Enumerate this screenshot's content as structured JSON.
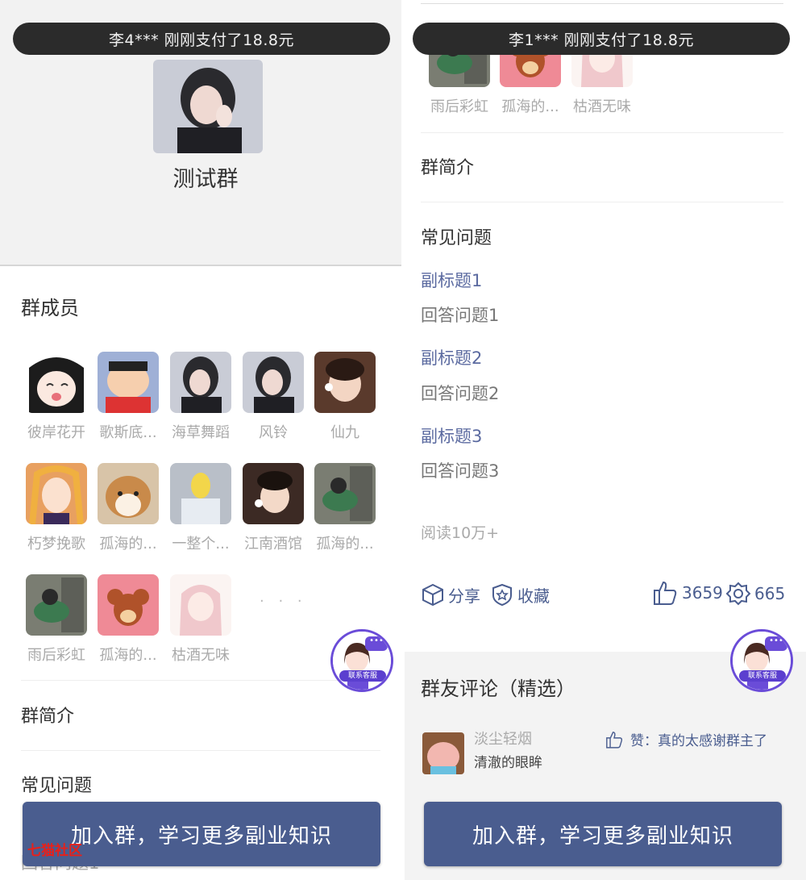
{
  "left": {
    "toast": "李4*** 刚刚支付了18.8元",
    "group_name": "测试群",
    "members_title": "群成员",
    "members": [
      {
        "name": "彼岸花开"
      },
      {
        "name": "歌斯底..."
      },
      {
        "name": "海草舞蹈"
      },
      {
        "name": "风铃"
      },
      {
        "name": "仙九"
      },
      {
        "name": "朽梦挽歌"
      },
      {
        "name": "孤海的..."
      },
      {
        "name": "一整个..."
      },
      {
        "name": "江南酒馆"
      },
      {
        "name": "孤海的..."
      },
      {
        "name": "雨后彩虹"
      },
      {
        "name": "孤海的..."
      },
      {
        "name": "枯酒无味"
      }
    ],
    "more": "· · ·",
    "intro_title": "群简介",
    "faq_title": "常见问题",
    "partial_text": "回答问题1",
    "cta": "加入群，学习更多副业知识",
    "watermark": "七猫社区",
    "service_label": "联系客服"
  },
  "right": {
    "toast": "李1*** 刚刚支付了18.8元",
    "top_members": [
      {
        "name": "雨后彩虹"
      },
      {
        "name": "孤海的..."
      },
      {
        "name": "枯酒无味"
      }
    ],
    "intro_title": "群简介",
    "faq_title": "常见问题",
    "faq": [
      {
        "q": "副标题1",
        "a": "回答问题1"
      },
      {
        "q": "副标题2",
        "a": "回答问题2"
      },
      {
        "q": "副标题3",
        "a": "回答问题3"
      }
    ],
    "reads": "阅读10万+",
    "share": "分享",
    "favorite": "收藏",
    "likes": "3659",
    "gifts": "665",
    "comments_title": "群友评论（精选）",
    "comment": {
      "user": "淡尘轻烟",
      "text": "清澈的眼眸",
      "praise": "赞：真的太感谢群主了"
    },
    "cta": "加入群，学习更多副业知识",
    "service_label": "联系客服"
  }
}
